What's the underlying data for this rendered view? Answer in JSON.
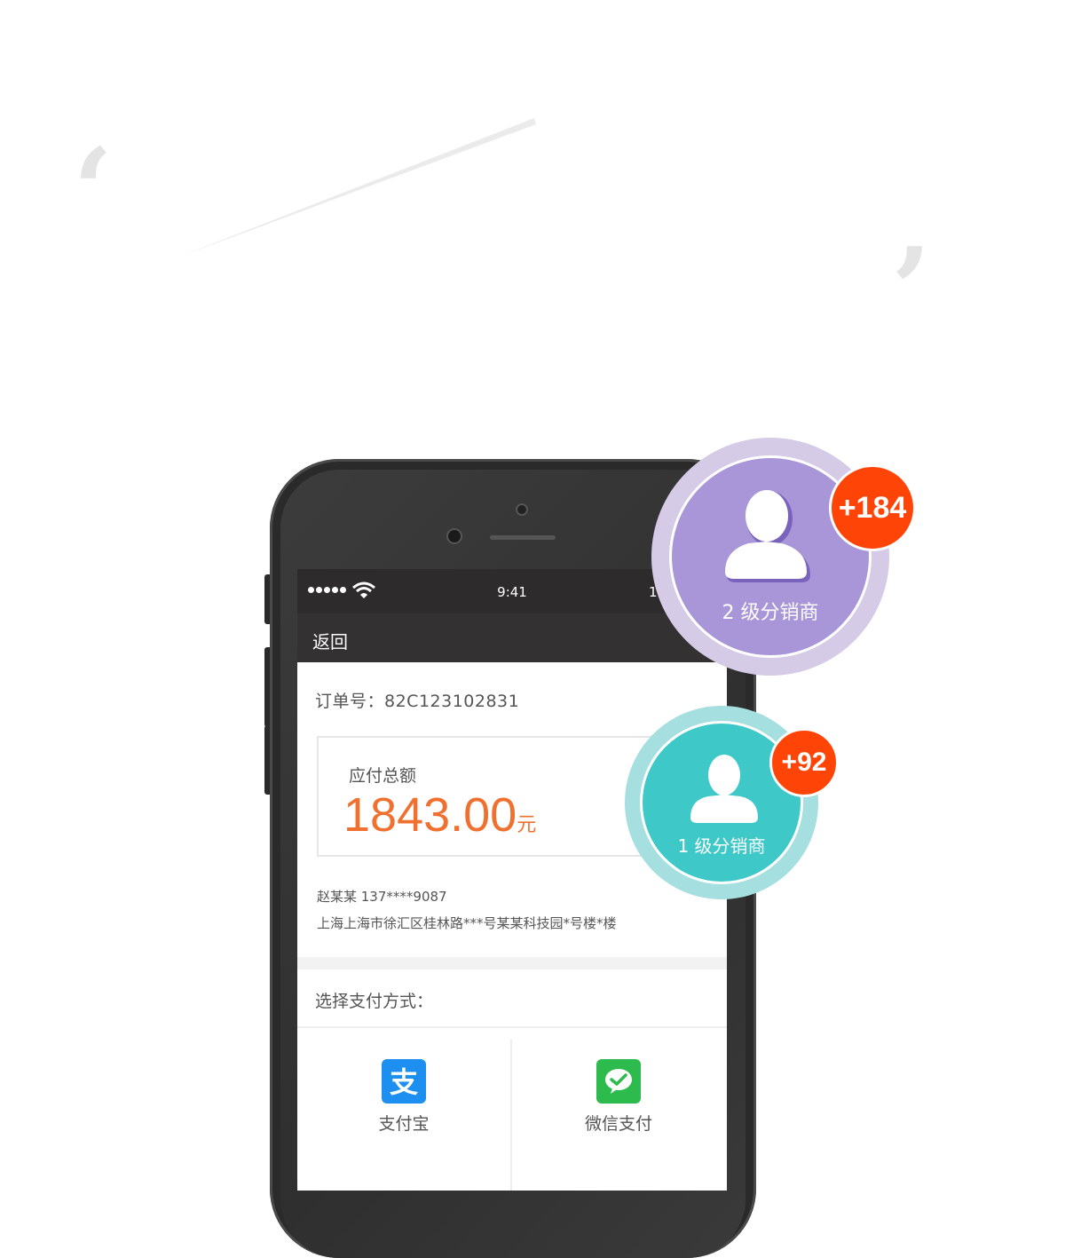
{
  "decor": {
    "open_quote": "‘",
    "close_quote": "’"
  },
  "status_bar": {
    "time": "9:41",
    "battery_text": "1",
    "signal_dots": 5,
    "wifi_icon": "wifi-icon"
  },
  "nav": {
    "back_label": "返回"
  },
  "order": {
    "number_label": "订单号：82C123102831"
  },
  "amount": {
    "label": "应付总额",
    "value": "1843.00",
    "unit": "元",
    "color": "#f07030"
  },
  "contact": {
    "name_phone": "赵某某 137****9087",
    "address": "上海上海市徐汇区桂林路***号某某科技园*号楼*楼"
  },
  "payment": {
    "title": "选择支付方式：",
    "options": [
      {
        "label": "支付宝",
        "icon": "alipay-icon",
        "color": "#1c8ff0"
      },
      {
        "label": "微信支付",
        "icon": "wechat-pay-icon",
        "color": "#2dbb4e"
      }
    ]
  },
  "distributors": [
    {
      "label": "2 级分销商",
      "count": "+184",
      "color": "#a896d8",
      "ring_color": "#d6cbe7"
    },
    {
      "label": "1 级分销商",
      "count": "+92",
      "color": "#3ec8c8",
      "ring_color": "#a6dfe0"
    }
  ]
}
